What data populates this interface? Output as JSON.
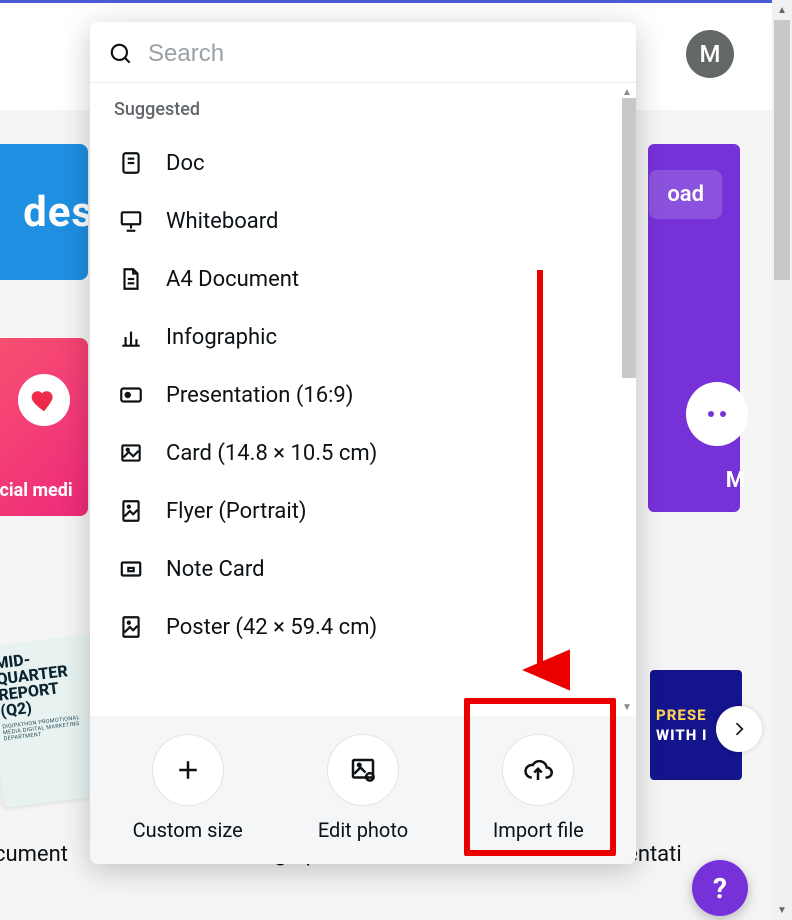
{
  "avatar": {
    "initial": "M"
  },
  "hero": {
    "upload_part": "oad",
    "more_label": "M"
  },
  "socialpeek": {
    "label": "ocial medi"
  },
  "peek_blue": {
    "text": "des"
  },
  "doc_card": {
    "l1": "MID-",
    "l2": "QUARTER",
    "l3": "REPORT",
    "l4": "(Q2)",
    "fine1": "DIGIPATHON PROMOTIONAL",
    "fine2": "MEDIA DIGITAL MARKETING",
    "fine3": "DEPARTMENT"
  },
  "thumb_pres": {
    "row1": "PRESE",
    "row2": "WITH I"
  },
  "bottom_labels": {
    "left": "cument",
    "center": "Infographic",
    "right": "Presentati"
  },
  "search": {
    "placeholder": "Search"
  },
  "section_label": "Suggested",
  "items": [
    {
      "label": "Doc",
      "icon": "doc"
    },
    {
      "label": "Whiteboard",
      "icon": "whiteboard"
    },
    {
      "label": "A4 Document",
      "icon": "a4"
    },
    {
      "label": "Infographic",
      "icon": "infographic"
    },
    {
      "label": "Presentation (16:9)",
      "icon": "presentation"
    },
    {
      "label": "Card (14.8 × 10.5 cm)",
      "icon": "card"
    },
    {
      "label": "Flyer (Portrait)",
      "icon": "flyer"
    },
    {
      "label": "Note Card",
      "icon": "note"
    },
    {
      "label": "Poster (42 × 59.4 cm)",
      "icon": "poster"
    }
  ],
  "actions": {
    "custom": "Custom size",
    "edit": "Edit photo",
    "import": "Import file"
  },
  "help": {
    "label": "?"
  }
}
